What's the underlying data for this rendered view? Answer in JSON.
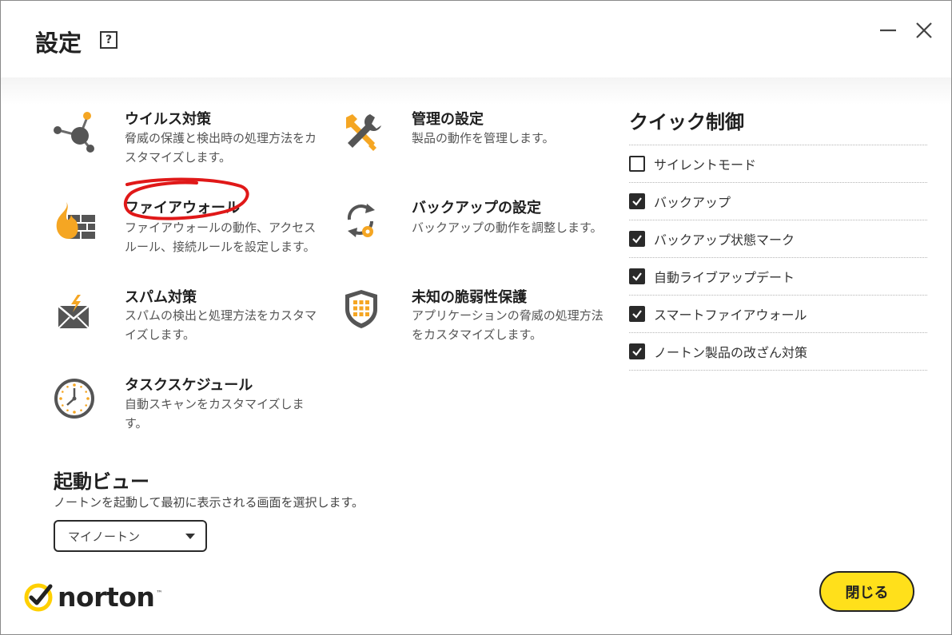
{
  "header": {
    "title": "設定",
    "help_label": "?"
  },
  "window_controls": {
    "minimize_icon": "minimize-icon",
    "close_icon": "close-icon"
  },
  "tiles": [
    {
      "title": "ウイルス対策",
      "desc": "脅威の保護と検出時の処理方法をカスタマイズします。",
      "icon": "network-nodes-icon"
    },
    {
      "title": "管理の設定",
      "desc": "製品の動作を管理します。",
      "icon": "tools-icon"
    },
    {
      "title": "ファイアウォール",
      "desc": "ファイアウォールの動作、アクセスルール、接続ルールを設定します。",
      "icon": "firewall-icon"
    },
    {
      "title": "バックアップの設定",
      "desc": "バックアップの動作を調整します。",
      "icon": "backup-gear-icon"
    },
    {
      "title": "スパム対策",
      "desc": "スパムの検出と処理方法をカスタマイズします。",
      "icon": "spam-mail-icon"
    },
    {
      "title": "未知の脆弱性保護",
      "desc": "アプリケーションの脅威の処理方法をカスタマイズします。",
      "icon": "shield-grid-icon"
    },
    {
      "title": "タスクスケジュール",
      "desc": "自動スキャンをカスタマイズします。",
      "icon": "clock-icon"
    }
  ],
  "quick_controls": {
    "title": "クイック制御",
    "items": [
      {
        "label": "サイレントモード",
        "checked": false
      },
      {
        "label": "バックアップ",
        "checked": true
      },
      {
        "label": "バックアップ状態マーク",
        "checked": true
      },
      {
        "label": "自動ライブアップデート",
        "checked": true
      },
      {
        "label": "スマートファイアウォール",
        "checked": true
      },
      {
        "label": "ノートン製品の改ざん対策",
        "checked": true
      }
    ]
  },
  "startup_view": {
    "title": "起動ビュー",
    "desc": "ノートンを起動して最初に表示される画面を選択します。",
    "selected": "マイノートン"
  },
  "footer": {
    "logo_text": "norton",
    "logo_tm": "™",
    "close_label": "閉じる"
  },
  "colors": {
    "accent_yellow": "#ffe01b",
    "icon_orange": "#f5a623",
    "icon_gray": "#555555",
    "annotation_red": "#e01818"
  }
}
